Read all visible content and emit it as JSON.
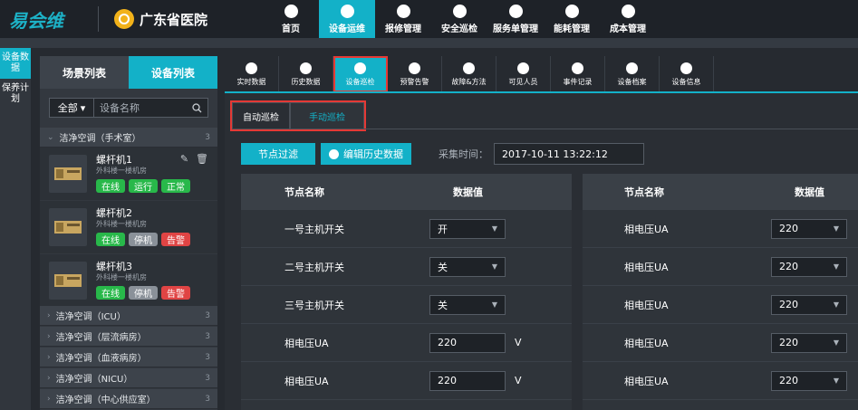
{
  "logo": "易会维",
  "hospital": "广东省医院",
  "main_nav": [
    {
      "label": "首页",
      "active": false
    },
    {
      "label": "设备运维",
      "active": true
    },
    {
      "label": "报修管理",
      "active": false
    },
    {
      "label": "安全巡检",
      "active": false
    },
    {
      "label": "服务单管理",
      "active": false
    },
    {
      "label": "能耗管理",
      "active": false
    },
    {
      "label": "成本管理",
      "active": false
    }
  ],
  "rail": [
    {
      "label": "设备数据",
      "active": true
    },
    {
      "label": "保养计划",
      "active": false
    }
  ],
  "panel_tabs": [
    {
      "label": "场景列表",
      "active": false
    },
    {
      "label": "设备列表",
      "active": true
    }
  ],
  "search": {
    "dropdown": "全部",
    "placeholder": "设备名称"
  },
  "groups": [
    {
      "label": "洁净空调（手术室）",
      "count": "3"
    },
    {
      "label": "洁净空调（ICU）",
      "count": "3"
    },
    {
      "label": "洁净空调（层流病房）",
      "count": "3"
    },
    {
      "label": "洁净空调（血液病房）",
      "count": "3"
    },
    {
      "label": "洁净空调（NICU）",
      "count": "3"
    },
    {
      "label": "洁净空调（中心供应室）",
      "count": "3"
    }
  ],
  "devices": [
    {
      "name": "螺杆机1",
      "location": "外科楼一楼机房",
      "badges": [
        {
          "label": "在线",
          "color": "#28b84a"
        },
        {
          "label": "运行",
          "color": "#28b84a"
        },
        {
          "label": "正常",
          "color": "#28b84a"
        }
      ]
    },
    {
      "name": "螺杆机2",
      "location": "外科楼一楼机房",
      "badges": [
        {
          "label": "在线",
          "color": "#28b84a"
        },
        {
          "label": "停机",
          "color": "#8a9199"
        },
        {
          "label": "告警",
          "color": "#e04444"
        }
      ]
    },
    {
      "name": "螺杆机3",
      "location": "外科楼一楼机房",
      "badges": [
        {
          "label": "在线",
          "color": "#28b84a"
        },
        {
          "label": "停机",
          "color": "#8a9199"
        },
        {
          "label": "告警",
          "color": "#e04444"
        }
      ]
    }
  ],
  "sub_tabs": [
    {
      "label": "实时数据",
      "active": false
    },
    {
      "label": "历史数据",
      "active": false
    },
    {
      "label": "设备巡检",
      "active": true
    },
    {
      "label": "预警告警",
      "active": false
    },
    {
      "label": "故障&方法",
      "active": false
    },
    {
      "label": "可见人员",
      "active": false
    },
    {
      "label": "事件记录",
      "active": false
    },
    {
      "label": "设备档案",
      "active": false
    },
    {
      "label": "设备信息",
      "active": false
    }
  ],
  "mode_tabs": [
    {
      "label": "自动巡检",
      "active": false
    },
    {
      "label": "手动巡检",
      "active": true
    }
  ],
  "buttons": {
    "filter": "节点过滤",
    "edit_history": "编辑历史数据"
  },
  "collect": {
    "label": "采集时间：",
    "value": "2017-10-11  13:22:12"
  },
  "table_headers": {
    "node": "节点名称",
    "value": "数据值"
  },
  "left_rows": [
    {
      "name": "一号主机开关",
      "type": "select",
      "value": "开",
      "unit": ""
    },
    {
      "name": "二号主机开关",
      "type": "select",
      "value": "关",
      "unit": ""
    },
    {
      "name": "三号主机开关",
      "type": "select",
      "value": "关",
      "unit": ""
    },
    {
      "name": "相电压UA",
      "type": "input",
      "value": "220",
      "unit": "V"
    },
    {
      "name": "相电压UA",
      "type": "input",
      "value": "220",
      "unit": "V"
    }
  ],
  "right_rows": [
    {
      "name": "相电压UA",
      "type": "select",
      "value": "220",
      "unit": ""
    },
    {
      "name": "相电压UA",
      "type": "select",
      "value": "220",
      "unit": ""
    },
    {
      "name": "相电压UA",
      "type": "select",
      "value": "220",
      "unit": ""
    },
    {
      "name": "相电压UA",
      "type": "select",
      "value": "220",
      "unit": ""
    },
    {
      "name": "相电压UA",
      "type": "select",
      "value": "220",
      "unit": ""
    }
  ],
  "colors": {
    "accent": "#13b1c8",
    "highlight": "#e53935",
    "online": "#28b84a",
    "alarm": "#e04444"
  }
}
